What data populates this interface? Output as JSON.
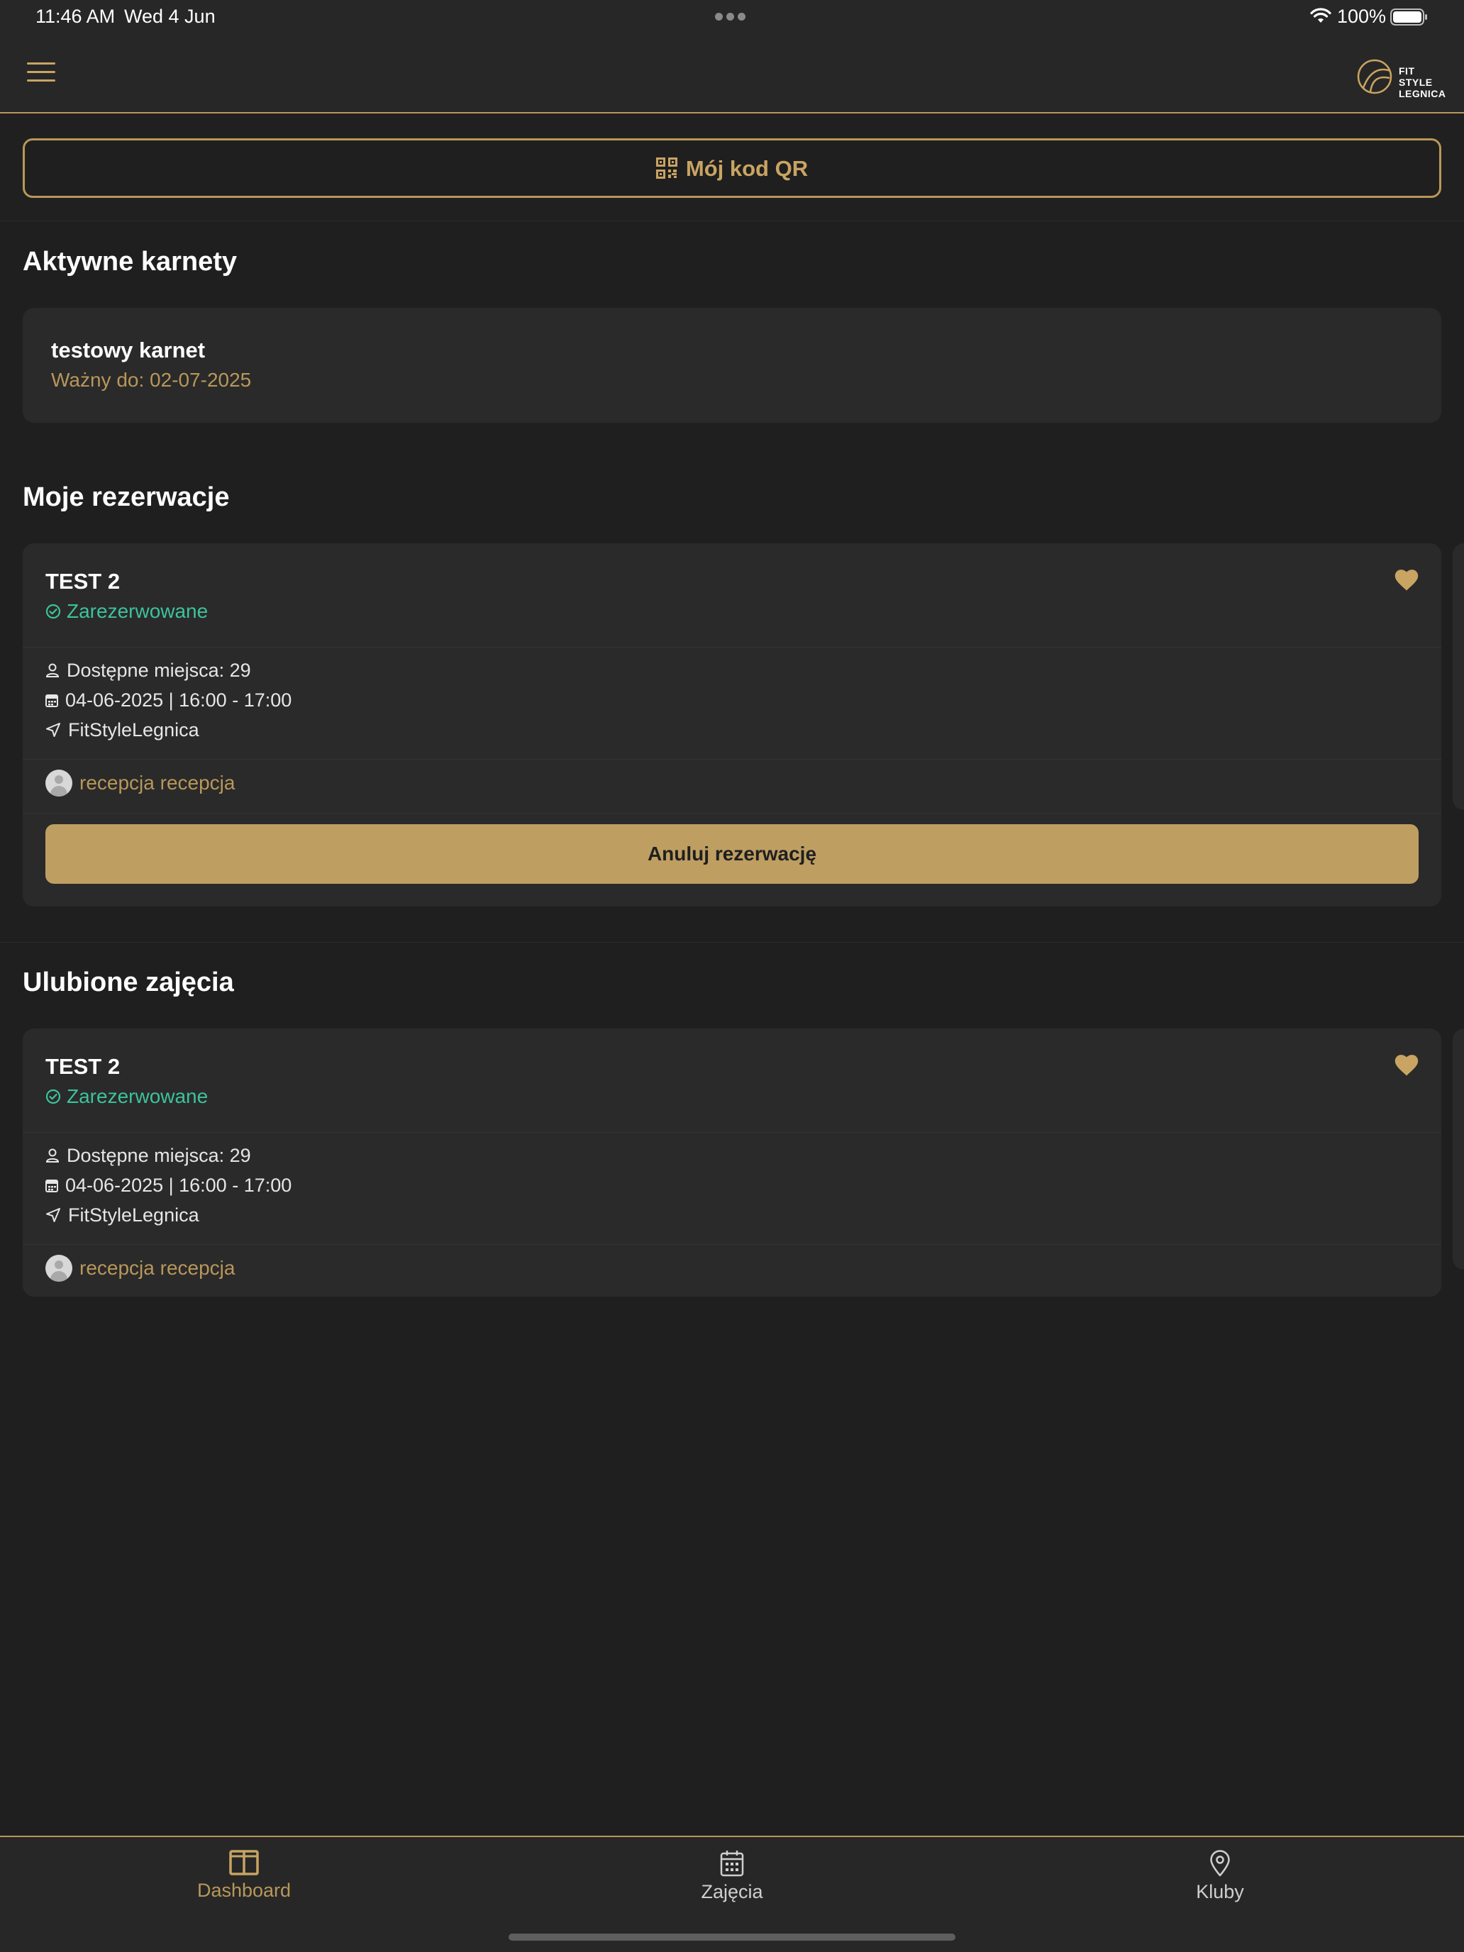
{
  "status_bar": {
    "time": "11:46 AM",
    "date": "Wed 4 Jun",
    "battery_percent": "100%"
  },
  "header": {
    "menu_icon": "hamburger-menu-icon",
    "logo_line1": "FIT STYLE",
    "logo_line2": "LEGNICA"
  },
  "qr_button": {
    "label": "Mój kod QR",
    "icon": "qr-code-icon"
  },
  "active_passes": {
    "title": "Aktywne karnety",
    "items": [
      {
        "name": "testowy karnet",
        "valid_until": "Ważny do: 02-07-2025"
      }
    ]
  },
  "my_bookings": {
    "title": "Moje rezerwacje",
    "items": [
      {
        "class_name": "TEST 2",
        "status": "Zarezerwowane",
        "available_spots": "Dostępne miejsca: 29",
        "datetime": "04-06-2025 | 16:00 - 17:00",
        "location": "FitStyleLegnica",
        "instructor": "recepcja recepcja",
        "cancel_label": "Anuluj rezerwację",
        "favorite": true
      }
    ]
  },
  "favorite_classes": {
    "title": "Ulubione zajęcia",
    "items": [
      {
        "class_name": "TEST 2",
        "status": "Zarezerwowane",
        "available_spots": "Dostępne miejsca: 29",
        "datetime": "04-06-2025 | 16:00 - 17:00",
        "location": "FitStyleLegnica",
        "instructor": "recepcja recepcja",
        "favorite": true
      }
    ]
  },
  "tabbar": {
    "tabs": [
      {
        "label": "Dashboard",
        "icon": "dashboard-icon",
        "active": true
      },
      {
        "label": "Zajęcia",
        "icon": "calendar-icon",
        "active": false
      },
      {
        "label": "Kluby",
        "icon": "location-pin-icon",
        "active": false
      }
    ]
  },
  "colors": {
    "background": "#1f1f1f",
    "surface": "#2a2a2a",
    "accent_gold": "#b8975a",
    "button_gold": "#bf9e62",
    "success_green": "#3cc39a",
    "inactive_tab": "#cfcfcf"
  }
}
